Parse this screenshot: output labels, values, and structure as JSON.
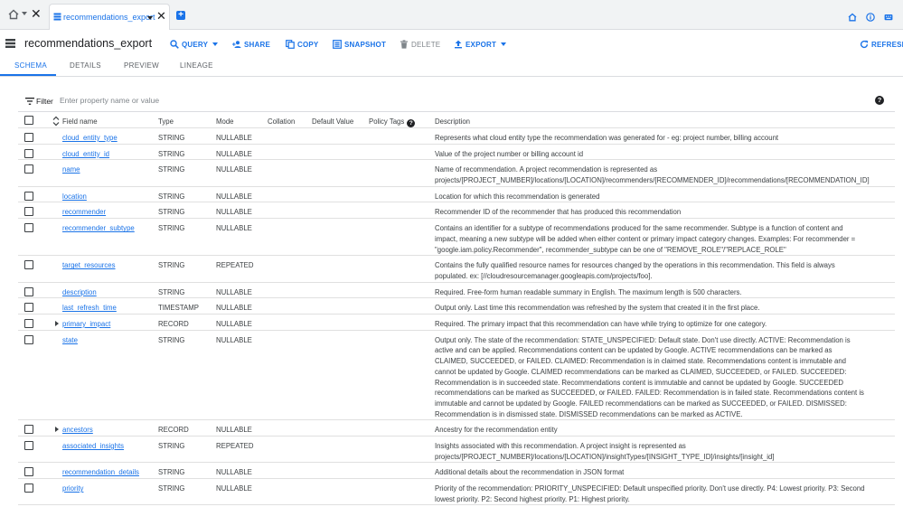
{
  "tabbar": {
    "active_tab": "recommendations_export",
    "close_glyph": "✕",
    "add_glyph": "+"
  },
  "toolbar": {
    "table_name": "recommendations_export",
    "query": "QUERY",
    "share": "SHARE",
    "copy": "COPY",
    "snapshot": "SNAPSHOT",
    "delete": "DELETE",
    "export": "EXPORT",
    "refresh": "REFRESH"
  },
  "subtabs": [
    "SCHEMA",
    "DETAILS",
    "PREVIEW",
    "LINEAGE"
  ],
  "filter": {
    "label": "Filter",
    "placeholder": "Enter property name or value",
    "help": "?"
  },
  "columns": {
    "field_name": "Field name",
    "type": "Type",
    "mode": "Mode",
    "collation": "Collation",
    "default_value": "Default Value",
    "policy_tags": "Policy Tags",
    "policy_help": "?",
    "description": "Description"
  },
  "rows": [
    {
      "name": "cloud_entity_type",
      "type": "STRING",
      "mode": "NULLABLE",
      "expandable": false,
      "description": "Represents what cloud entity type the recommendation was generated for - eg: project number, billing account"
    },
    {
      "name": "cloud_entity_id",
      "type": "STRING",
      "mode": "NULLABLE",
      "expandable": false,
      "description": "Value of the project number or billing account id"
    },
    {
      "name": "name",
      "type": "STRING",
      "mode": "NULLABLE",
      "expandable": false,
      "description": "Name of recommendation. A project recommendation is represented as projects/[PROJECT_NUMBER]/locations/[LOCATION]/recommenders/[RECOMMENDER_ID]/recommendations/[RECOMMENDATION_ID]"
    },
    {
      "name": "location",
      "type": "STRING",
      "mode": "NULLABLE",
      "expandable": false,
      "description": "Location for which this recommendation is generated"
    },
    {
      "name": "recommender",
      "type": "STRING",
      "mode": "NULLABLE",
      "expandable": false,
      "description": "Recommender ID of the recommender that has produced this recommendation"
    },
    {
      "name": "recommender_subtype",
      "type": "STRING",
      "mode": "NULLABLE",
      "expandable": false,
      "description": "Contains an identifier for a subtype of recommendations produced for the same recommender. Subtype is a function of content and impact, meaning a new subtype will be added when either content or primary impact category changes. Examples: For recommender = \"google.iam.policy.Recommender\", recommender_subtype can be one of \"REMOVE_ROLE\"/\"REPLACE_ROLE\""
    },
    {
      "name": "target_resources",
      "type": "STRING",
      "mode": "REPEATED",
      "expandable": false,
      "description": "Contains the fully qualified resource names for resources changed by the operations in this recommendation. This field is always populated. ex: [//cloudresourcemanager.googleapis.com/projects/foo]."
    },
    {
      "name": "description",
      "type": "STRING",
      "mode": "NULLABLE",
      "expandable": false,
      "description": "Required. Free-form human readable summary in English. The maximum length is 500 characters."
    },
    {
      "name": "last_refresh_time",
      "type": "TIMESTAMP",
      "mode": "NULLABLE",
      "expandable": false,
      "description": "Output only. Last time this recommendation was refreshed by the system that created it in the first place."
    },
    {
      "name": "primary_impact",
      "type": "RECORD",
      "mode": "NULLABLE",
      "expandable": true,
      "description": "Required. The primary impact that this recommendation can have while trying to optimize for one category."
    },
    {
      "name": "state",
      "type": "STRING",
      "mode": "NULLABLE",
      "expandable": false,
      "description": "Output only. The state of the recommendation: STATE_UNSPECIFIED: Default state. Don't use directly. ACTIVE: Recommendation is active and can be applied. Recommendations content can be updated by Google. ACTIVE recommendations can be marked as CLAIMED, SUCCEEDED, or FAILED. CLAIMED: Recommendation is in claimed state. Recommendations content is immutable and cannot be updated by Google. CLAIMED recommendations can be marked as CLAIMED, SUCCEEDED, or FAILED. SUCCEEDED: Recommendation is in succeeded state. Recommendations content is immutable and cannot be updated by Google. SUCCEEDED recommendations can be marked as SUCCEEDED, or FAILED. FAILED: Recommendation is in failed state. Recommendations content is immutable and cannot be updated by Google. FAILED recommendations can be marked as SUCCEEDED, or FAILED. DISMISSED: Recommendation is in dismissed state. DISMISSED recommendations can be marked as ACTIVE."
    },
    {
      "name": "ancestors",
      "type": "RECORD",
      "mode": "NULLABLE",
      "expandable": true,
      "description": "Ancestry for the recommendation entity"
    },
    {
      "name": "associated_insights",
      "type": "STRING",
      "mode": "REPEATED",
      "expandable": false,
      "description": "Insights associated with this recommendation. A project insight is represented as projects/[PROJECT_NUMBER]/locations/[LOCATION]/insightTypes/[INSIGHT_TYPE_ID]/insights/[insight_id]"
    },
    {
      "name": "recommendation_details",
      "type": "STRING",
      "mode": "NULLABLE",
      "expandable": false,
      "description": "Additional details about the recommendation in JSON format"
    },
    {
      "name": "priority",
      "type": "STRING",
      "mode": "NULLABLE",
      "expandable": false,
      "description": "Priority of the recommendation: PRIORITY_UNSPECIFIED: Default unspecified priority. Don't use directly. P4: Lowest priority. P3: Second lowest priority. P2: Second highest priority. P1: Highest priority."
    }
  ]
}
